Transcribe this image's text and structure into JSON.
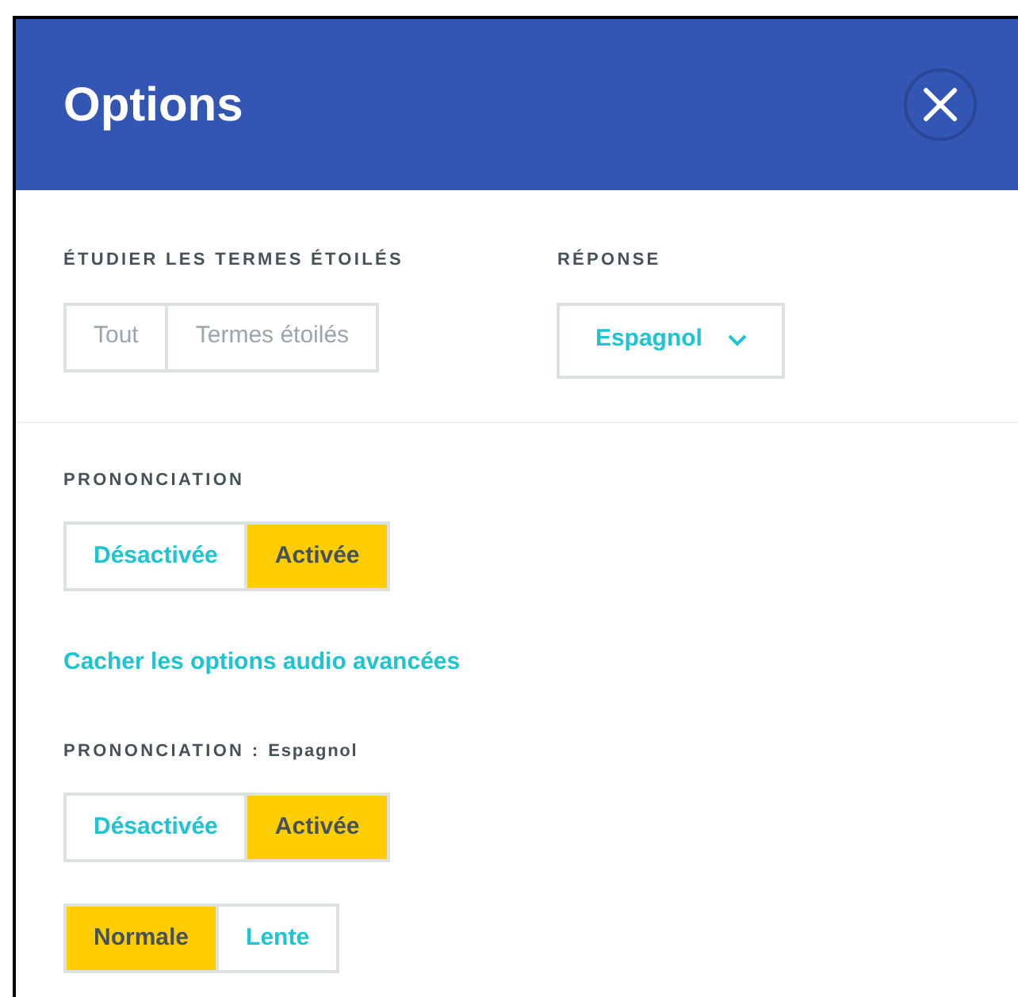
{
  "dialog": {
    "title": "Options"
  },
  "starred": {
    "label": "ÉTUDIER LES TERMES ÉTOILÉS",
    "disabled": true,
    "options": [
      {
        "label": "Tout",
        "selected": false
      },
      {
        "label": "Termes étoilés",
        "selected": false
      }
    ]
  },
  "answer": {
    "label": "RÉPONSE",
    "value": "Espagnol"
  },
  "pronunciation": {
    "label": "PRONONCIATION",
    "disabled": false,
    "options": [
      {
        "label": "Désactivée",
        "selected": false
      },
      {
        "label": "Activée",
        "selected": true
      }
    ]
  },
  "advanced_link": "Cacher les options audio avancées",
  "pronunciation_language": {
    "label": "PRONONCIATION :",
    "language": "Espagnol",
    "disabled": false,
    "options": [
      {
        "label": "Désactivée",
        "selected": false
      },
      {
        "label": "Activée",
        "selected": true
      }
    ]
  },
  "speed": {
    "disabled": false,
    "options": [
      {
        "label": "Normale",
        "selected": true
      },
      {
        "label": "Lente",
        "selected": false
      }
    ]
  }
}
